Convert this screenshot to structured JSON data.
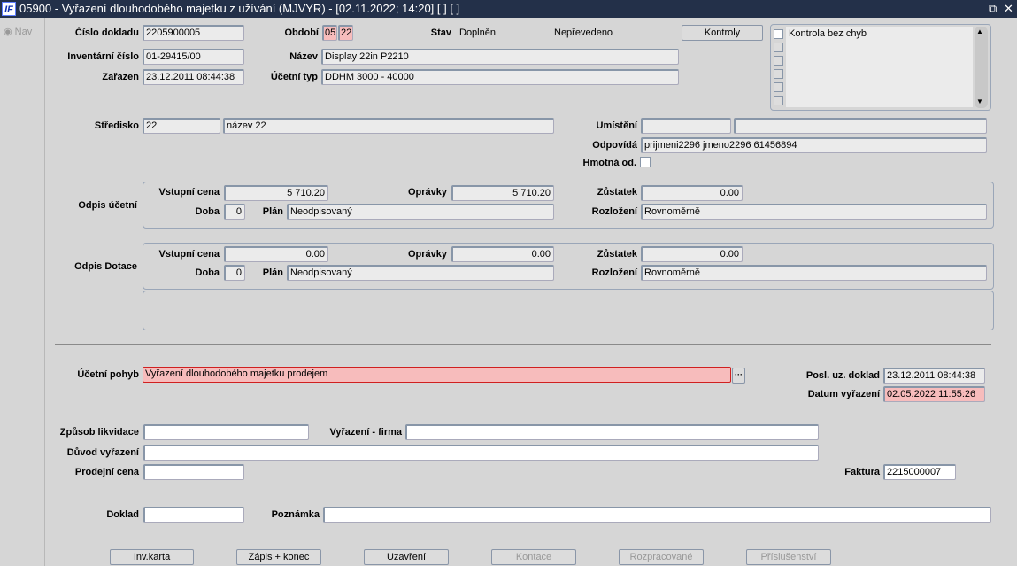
{
  "window": {
    "title": "05900 - Vyřazení dlouhodobého majetku z užívání (MJVYR) - [02.11.2022; 14:20]  [ ]  [ ]",
    "logo": "IF",
    "restore_icon": "⧉",
    "close_icon": "✕"
  },
  "nav": {
    "label": "Nav"
  },
  "header": {
    "cislo_dokladu": {
      "label": "Číslo dokladu",
      "value": "2205900005"
    },
    "inventarni_cislo": {
      "label": "Inventární číslo",
      "value": "01-29415/00"
    },
    "zarazen": {
      "label": "Zařazen",
      "value": "23.12.2011 08:44:38"
    },
    "obdobi": {
      "label": "Období",
      "month": "05",
      "year": "22"
    },
    "stav": {
      "label": "Stav",
      "value": "Doplněn",
      "value2": "Nepřevedeno"
    },
    "nazev": {
      "label": "Název",
      "value": "Display 22in P2210"
    },
    "ucetni_typ": {
      "label": "Účetní typ",
      "value": "DDHM 3000 - 40000"
    },
    "kontroly_button": "Kontroly",
    "kontroly_list": [
      "Kontrola bez chyb"
    ]
  },
  "location": {
    "stredisko": {
      "label": "Středisko",
      "code": "22",
      "name": "název 22"
    },
    "umisteni": {
      "label": "Umístění",
      "code": "",
      "name": ""
    },
    "odpovida": {
      "label": "Odpovídá",
      "value": "prijmeni2296 jmeno2296 61456894"
    },
    "hmotna_od": {
      "label": "Hmotná od.",
      "checked": false
    }
  },
  "odpis_ucetni": {
    "title": "Odpis účetní",
    "vstupni_cena_label": "Vstupní cena",
    "vstupni_cena": "5 710.20",
    "opravky_label": "Oprávky",
    "opravky": "5 710.20",
    "zustatek_label": "Zůstatek",
    "zustatek": "0.00",
    "doba_label": "Doba",
    "doba": "0",
    "plan_label": "Plán",
    "plan": "Neodpisovaný",
    "rozlozeni_label": "Rozložení",
    "rozlozeni": "Rovnoměrně"
  },
  "odpis_dotace": {
    "title": "Odpis Dotace",
    "vstupni_cena_label": "Vstupní cena",
    "vstupni_cena": "0.00",
    "opravky_label": "Oprávky",
    "opravky": "0.00",
    "zustatek_label": "Zůstatek",
    "zustatek": "0.00",
    "doba_label": "Doba",
    "doba": "0",
    "plan_label": "Plán",
    "plan": "Neodpisovaný",
    "rozlozeni_label": "Rozložení",
    "rozlozeni": "Rovnoměrně"
  },
  "vyrazeni": {
    "ucetni_pohyb": {
      "label": "Účetní pohyb",
      "value": "Vyřazení dlouhodobého majetku prodejem",
      "lov_button": "···"
    },
    "posl_uz_doklad": {
      "label": "Posl. uz. doklad",
      "value": "23.12.2011 08:44:38"
    },
    "datum_vyrazeni": {
      "label": "Datum vyřazení",
      "value": "02.05.2022 11:55:26"
    },
    "zpusob_likvidace": {
      "label": "Způsob likvidace",
      "value": ""
    },
    "vyrazeni_firma": {
      "label": "Vyřazení - firma",
      "value": ""
    },
    "duvod_vyrazeni": {
      "label": "Důvod vyřazení",
      "value": ""
    },
    "prodejni_cena": {
      "label": "Prodejní cena",
      "value": ""
    },
    "faktura": {
      "label": "Faktura",
      "value": "2215000007"
    },
    "doklad": {
      "label": "Doklad",
      "value": ""
    },
    "poznamka": {
      "label": "Poznámka",
      "value": ""
    }
  },
  "buttons": {
    "inv_karta": "Inv.karta",
    "zapis_konec": "Zápis + konec",
    "uzavreni": "Uzavření",
    "kontace": "Kontace",
    "rozpracovane": "Rozpracované",
    "prislusenstvi": "Příslušenství"
  }
}
